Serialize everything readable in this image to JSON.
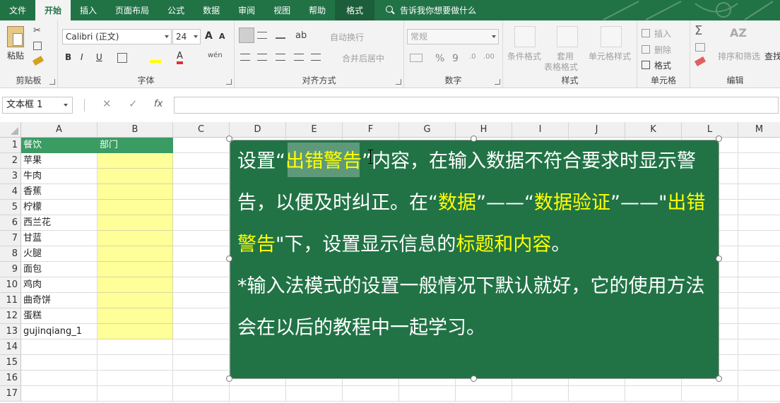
{
  "tabs": [
    "文件",
    "开始",
    "插入",
    "页面布局",
    "公式",
    "数据",
    "审阅",
    "视图",
    "帮助",
    "格式"
  ],
  "active_tab": "开始",
  "tell_me": "告诉我你想要做什么",
  "ribbon": {
    "clipboard": {
      "paste": "粘贴",
      "label": "剪贴板"
    },
    "font": {
      "name": "Calibri (正文)",
      "size": "24",
      "bold": "B",
      "italic": "I",
      "underline": "U",
      "grow": "A",
      "shrink": "A",
      "wen": "wén",
      "label": "字体"
    },
    "align": {
      "wrap": "自动换行",
      "merge": "合并后居中",
      "label": "对齐方式"
    },
    "number": {
      "format": "常规",
      "percent": "%",
      "comma": "9",
      "label": "数字"
    },
    "styles": {
      "cond": "条件格式",
      "table": "套用\n表格格式",
      "table1": "套用",
      "table2": "表格格式",
      "cell": "单元格样式",
      "label": "样式"
    },
    "cells": {
      "insert": "插入",
      "delete": "删除",
      "format": "格式",
      "label": "单元格"
    },
    "editing": {
      "sort": "排序和筛选",
      "find": "查找",
      "sigma": "Σ",
      "label": "编辑"
    }
  },
  "name_box": "文本框 1",
  "fx": "fx",
  "columns": [
    "A",
    "B",
    "C",
    "D",
    "E",
    "F",
    "G",
    "H",
    "I",
    "J",
    "K",
    "L",
    "M"
  ],
  "rows": [
    "1",
    "2",
    "3",
    "4",
    "5",
    "6",
    "7",
    "8",
    "9",
    "10",
    "11",
    "12",
    "13",
    "14",
    "15",
    "16",
    "17"
  ],
  "cells": {
    "A1": "餐饮",
    "B1": "部门",
    "A": [
      "苹果",
      "牛肉",
      "香蕉",
      "柠檬",
      "西兰花",
      "甘蓝",
      "火腿",
      "面包",
      "鸡肉",
      "曲奇饼",
      "蛋糕",
      "gujinqiang_1"
    ]
  },
  "textbox": {
    "p1": {
      "a": "设置“",
      "b": "出错警告",
      "c": "”内容，在输入数据不符合要求时显示警告，以便及时纠正。在“",
      "d": "数据",
      "e": "”——“",
      "f": "数据验证",
      "g": "”——\"",
      "h": "出错警告",
      "i": "\"下，设置显示信息的",
      "j": "标题和内容",
      "k": "。"
    },
    "p2": "*输入法模式的设置一般情况下默认就好，它的使用方法会在以后的教程中一起学习。"
  },
  "colors": {
    "excel_green": "#217346",
    "highlight": "#ffff00",
    "yellow_fill": "#ffff99",
    "header_green": "#3a9b63"
  }
}
